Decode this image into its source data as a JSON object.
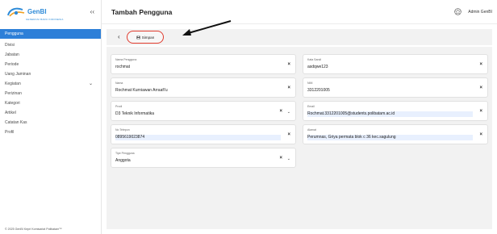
{
  "brand": {
    "name": "GenBI",
    "sub": "GENERASI BARU INDONESIA"
  },
  "sidebar": {
    "collapse_icon": "double-chevron-left",
    "items": [
      {
        "label": "Pengguna",
        "active": true
      },
      {
        "label": "Divisi"
      },
      {
        "label": "Jabatan"
      },
      {
        "label": "Periode"
      },
      {
        "label": "Uang Jaminan"
      },
      {
        "label": "Kegiatan",
        "has_dropdown": true
      },
      {
        "label": "Perizinan"
      },
      {
        "label": "Kategori"
      },
      {
        "label": "Artikel"
      },
      {
        "label": "Catatan Kas"
      },
      {
        "label": "Profil"
      }
    ],
    "footer": "© 2025 GenBI Kepri Komisariat Polibatam™"
  },
  "header": {
    "title": "Tambah Pengguna",
    "user": "Admin GenBI"
  },
  "actions": {
    "back": "‹",
    "save_label": "Simpan"
  },
  "form": {
    "nama_pengguna": {
      "label": "Nama Pengguna",
      "value": "rochmat"
    },
    "kata_sandi": {
      "label": "Kata Sandi",
      "value": "asdqwe123"
    },
    "nama": {
      "label": "Nama",
      "value": "Rochmat Kurniawan Arraafi'u"
    },
    "nim": {
      "label": "NIM",
      "value": "3312201005"
    },
    "prodi": {
      "label": "Prodi",
      "value": "D3 Teknik Informatika"
    },
    "email": {
      "label": "Email",
      "value": "Rochmat.3312201005@students.polibatam.ac.id"
    },
    "no_telepon": {
      "label": "No Telepon",
      "value": "0895619023874"
    },
    "alamat": {
      "label": "Alamat",
      "value": "Perumnas, Griya permata blok c 36 kec.sagulung"
    },
    "tipe_pengguna": {
      "label": "Tipe Pengguna",
      "value": "Anggota"
    }
  },
  "colors": {
    "accent": "#2d7fd8",
    "highlight": "#e03b2e"
  }
}
